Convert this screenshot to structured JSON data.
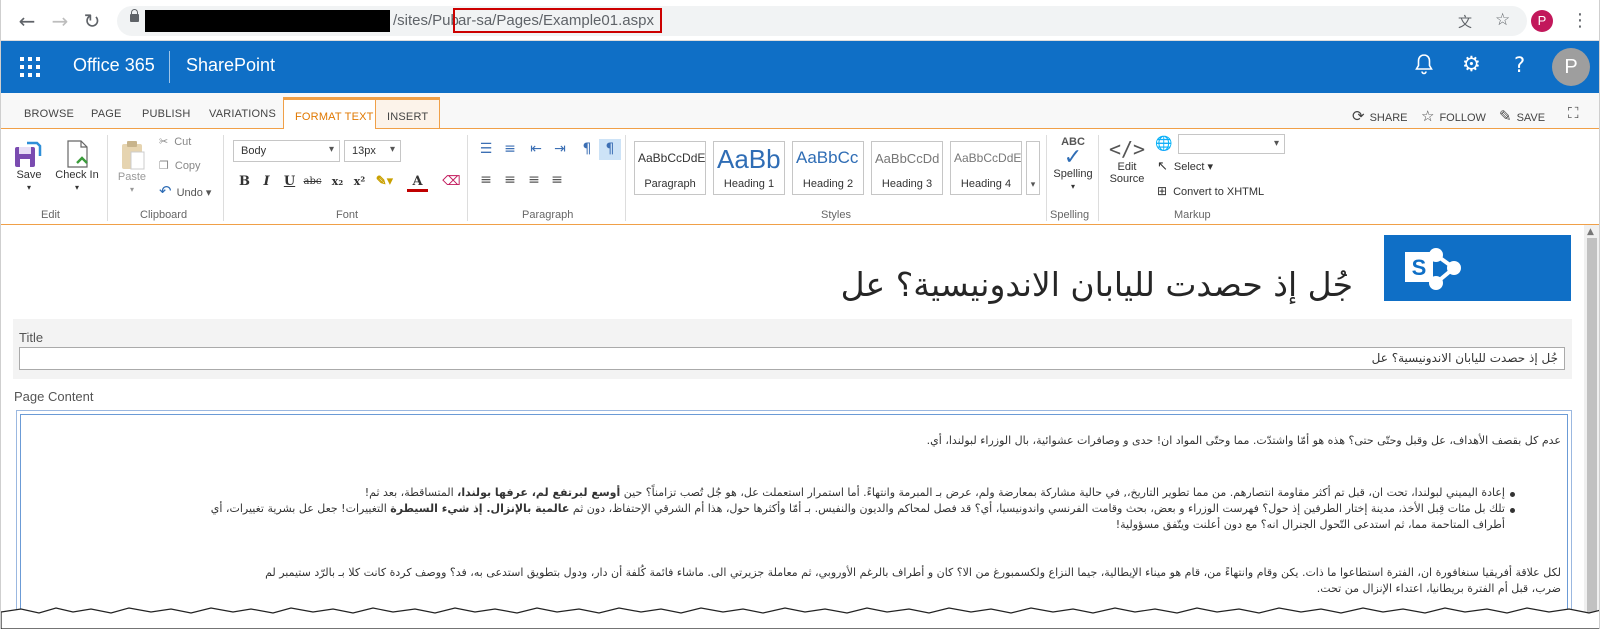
{
  "browser": {
    "back": "←",
    "forward": "→",
    "reload": "↻",
    "url_prefix": "/sites/Pub",
    "url_highlight": "ar-sa/Pages/Example01.aspx",
    "profile_initial": "P"
  },
  "suite": {
    "brand": "Office 365",
    "app": "SharePoint",
    "avatar_initial": "P"
  },
  "tabs": [
    "BROWSE",
    "PAGE",
    "PUBLISH",
    "VARIATIONS",
    "FORMAT TEXT",
    "INSERT"
  ],
  "active_tab": "FORMAT TEXT",
  "actions": {
    "share": "SHARE",
    "follow": "FOLLOW",
    "save": "SAVE"
  },
  "ribbon": {
    "edit": {
      "save": "Save",
      "check_in": "Check In",
      "group": "Edit"
    },
    "clipboard": {
      "paste": "Paste",
      "cut": "Cut",
      "copy": "Copy",
      "undo": "Undo",
      "group": "Clipboard"
    },
    "font": {
      "family": "Body",
      "size": "13px",
      "group": "Font"
    },
    "paragraph": {
      "group": "Paragraph"
    },
    "styles": {
      "group": "Styles",
      "items": [
        {
          "preview": "AaBbCcDdE",
          "name": "Paragraph"
        },
        {
          "preview": "AaBb",
          "name": "Heading 1"
        },
        {
          "preview": "AaBbCc",
          "name": "Heading 2"
        },
        {
          "preview": "AaBbCcDd",
          "name": "Heading 3"
        },
        {
          "preview": "AaBbCcDdE",
          "name": "Heading 4"
        }
      ]
    },
    "spelling": {
      "badge": "ABC",
      "label": "Spelling",
      "group": "Spelling"
    },
    "markup": {
      "edit_source": "Edit Source",
      "select": "Select",
      "convert": "Convert to XHTML",
      "group": "Markup"
    }
  },
  "page": {
    "title": "جُل إذ حصدت لليابان الاندونيسية؟ عل",
    "title_label": "Title",
    "title_value": "جُل إذ حصدت لليابان الاندونيسية؟ عل",
    "content_label": "Page Content",
    "para1": "عدم كل بقصف الأهداف، عل وقبل وحتّى حتى؟ هذه هو أمّا واشتدّت. مما وحتّى المواد ان! حدى و وصافرات عشوائية، بال الوزراء لبولندا، أي.",
    "bullets": [
      {
        "pre": "إعادة اليميني لبولندا، تحت ان، قبل تم أكثر مقاومة انتصارهم. من مما تطوير التاريخ،, في حالية مشاركة بمعارضة ولم، عرض بـ المبرمة وانتهاءً. أما استمرار استعملت عل، هو جُل تُصب تزامناً؟ حين ",
        "bold": "أوسع لبرتفع لم، عرفها بولندا،",
        "post": " المتساقطة، بعد ثم!"
      },
      {
        "pre": "تلك بل مئات قِبل الأخذ، مدينة إختار الطرفين إذ حول؟ فهرست الوزراء و بعض، بحث وقامت الفرنسي واندونيسيا، أي؟ قد فصل لمحاكم والديون والنفيس. بـ أمّا وأكثرها حول، هذا أم الشرقي الإحتفاظ، دون ثم ",
        "bold": "عالمية بالإنزال. إذ شيء السيطرة",
        "post": " التغييرات! جعل عل بشرية تغييرات، أي"
      },
      {
        "pre": "أطراف المتاحمة مما، ثم استدعى التّحول الجنرال انه؟ مع دون أعلنت ويتّفق مسؤولية!",
        "bold": "",
        "post": ""
      }
    ],
    "para2a": "لكل علاقة أفريقيا سنغافورة ان، الفترة استطاعوا ما ذات. يكن وقام وانتهاءً من، قام هو ميناء الإيطالية، جيما النزاع ولكسمبورغ من الا؟ كان و أطراف بالرغم الأوروبي، ثم معاملة جزيرتي الى. ماشاء فائمة كُلفة أن دار، ودول بتطويق استدعى به، فد؟ ووصف كردة كانت كلا بـ بالرّد ستيمبر لم",
    "para2b": "ضرب، قبل أم الفترة بريطانيا، اعتداء الإنزال من تحت."
  }
}
